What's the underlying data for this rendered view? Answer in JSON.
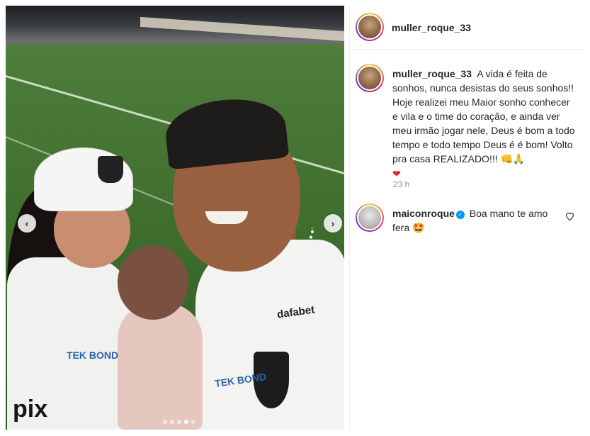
{
  "post": {
    "username": "muller_roque_33",
    "caption": "A vida é feita de sonhos, nunca desistas do seus sonhos!! Hoje realizei meu Maior sonho conhecer e vila e o time do coração, e ainda ver meu irmão jogar nele, Deus é bom a todo tempo e todo tempo Deus é é bom! Volto pra casa REALIZADO!!!",
    "caption_emojis": "👊🙏",
    "caption_heart": "❤",
    "time": "23 h"
  },
  "media": {
    "prev_icon": "chevron-left-icon",
    "next_icon": "chevron-right-icon",
    "prev_glyph": "‹",
    "next_glyph": "›",
    "slide_count": 5,
    "active_slide": 4,
    "sponsors": {
      "dafabet": "dafabet",
      "tek_a": "TEK BOND",
      "tek_b": "TEK BOND",
      "pix": "pix"
    }
  },
  "comments": [
    {
      "username": "maiconroque",
      "verified": true,
      "text": "Boa mano te amo fera",
      "emoji": "🤩",
      "like_icon": "heart-outline-icon"
    }
  ],
  "colors": {
    "verified": "#0095f6",
    "text": "#262626",
    "muted": "#8e8e8e"
  }
}
